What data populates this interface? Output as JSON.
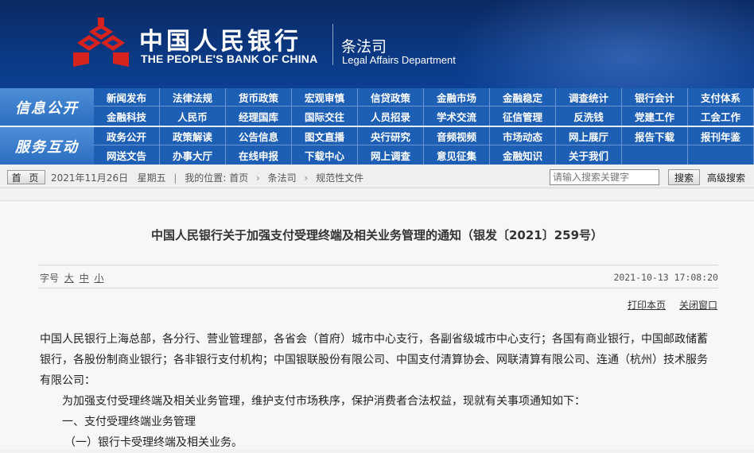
{
  "header": {
    "bank_name_cn": "中国人民银行",
    "bank_name_en": "THE PEOPLE'S BANK OF CHINA",
    "dept_cn": "条法司",
    "dept_en": "Legal Affairs Department",
    "logo_icon": "pboc-logo-icon",
    "colors": {
      "banner": "#0b3a86",
      "logo_red": "#d7231d",
      "nav": "#1d5fb5"
    }
  },
  "nav_info": {
    "label": "信息公开",
    "row1": [
      "新闻发布",
      "法律法规",
      "货币政策",
      "宏观审慎",
      "信贷政策",
      "金融市场",
      "金融稳定",
      "调查统计",
      "银行会计",
      "支付体系"
    ],
    "row2": [
      "金融科技",
      "人民币",
      "经理国库",
      "国际交往",
      "人员招录",
      "学术交流",
      "征信管理",
      "反洗钱",
      "党建工作",
      "工会工作"
    ]
  },
  "nav_service": {
    "label": "服务互动",
    "row1": [
      "政务公开",
      "政策解读",
      "公告信息",
      "图文直播",
      "央行研究",
      "音频视频",
      "市场动态",
      "网上展厅",
      "报告下载",
      "报刊年鉴"
    ],
    "row2": [
      "网送文告",
      "办事大厅",
      "在线申报",
      "下载中心",
      "网上调查",
      "意见征集",
      "金融知识",
      "关于我们",
      "",
      ""
    ]
  },
  "breadcrumb": {
    "home_label": "首 页",
    "date": "2021年11月26日",
    "weekday": "星期五",
    "location_label": "我的位置",
    "home_link": "首页",
    "level1": "条法司",
    "level2": "规范性文件"
  },
  "search": {
    "placeholder": "请输入搜索关键字",
    "button": "搜索",
    "advanced": "高级搜索"
  },
  "document": {
    "title": "中国人民银行关于加强支付受理终端及相关业务管理的通知（银发〔2021〕259号）",
    "font_size_label": "字号",
    "font_large": "大",
    "font_medium": "中",
    "font_small": "小",
    "timestamp": "2021-10-13  17:08:20",
    "print_label": "打印本页",
    "close_label": "关闭窗口",
    "paragraphs": [
      "中国人民银行上海总部，各分行、营业管理部，各省会（首府）城市中心支行，各副省级城市中心支行；各国有商业银行，中国邮政储蓄银行，各股份制商业银行；各非银行支付机构；中国银联股份有限公司、中国支付清算协会、网联清算有限公司、连通（杭州）技术服务有限公司：",
      "为加强支付受理终端及相关业务管理，维护支付市场秩序，保护消费者合法权益，现就有关事项通知如下：",
      "一、支付受理终端业务管理",
      "（一）银行卡受理终端及相关业务。"
    ]
  }
}
